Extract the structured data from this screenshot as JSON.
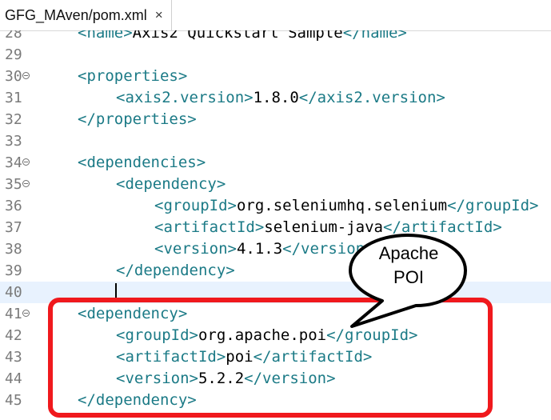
{
  "tab": {
    "title": "GFG_MAven/pom.xml",
    "close_glyph": "×"
  },
  "lines": [
    {
      "n": "28",
      "indent": 1,
      "parts": [
        [
          "tag",
          "<name>"
        ],
        [
          "txt",
          "Axis2 Quickstart Sample"
        ],
        [
          "tag",
          "</name>"
        ]
      ]
    },
    {
      "n": "29",
      "indent": 0,
      "parts": []
    },
    {
      "n": "30",
      "fold": true,
      "indent": 1,
      "parts": [
        [
          "tag",
          "<properties>"
        ]
      ]
    },
    {
      "n": "31",
      "indent": 2,
      "parts": [
        [
          "tag",
          "<axis2.version>"
        ],
        [
          "txt",
          "1.8.0"
        ],
        [
          "tag",
          "</axis2.version>"
        ]
      ]
    },
    {
      "n": "32",
      "indent": 1,
      "parts": [
        [
          "tag",
          "</properties>"
        ]
      ]
    },
    {
      "n": "33",
      "indent": 0,
      "parts": []
    },
    {
      "n": "34",
      "fold": true,
      "indent": 1,
      "parts": [
        [
          "tag",
          "<dependencies>"
        ]
      ]
    },
    {
      "n": "35",
      "fold": true,
      "indent": 2,
      "parts": [
        [
          "tag",
          "<dependency>"
        ]
      ]
    },
    {
      "n": "36",
      "indent": 3,
      "parts": [
        [
          "tag",
          "<groupId>"
        ],
        [
          "txt",
          "org.seleniumhq.selenium"
        ],
        [
          "tag",
          "</groupId>"
        ]
      ]
    },
    {
      "n": "37",
      "indent": 3,
      "parts": [
        [
          "tag",
          "<artifactId>"
        ],
        [
          "txt",
          "selenium-java"
        ],
        [
          "tag",
          "</artifactId>"
        ]
      ]
    },
    {
      "n": "38",
      "indent": 3,
      "parts": [
        [
          "tag",
          "<version>"
        ],
        [
          "txt",
          "4.1.3"
        ],
        [
          "tag",
          "</version>"
        ]
      ]
    },
    {
      "n": "39",
      "indent": 2,
      "parts": [
        [
          "tag",
          "</dependency>"
        ]
      ]
    },
    {
      "n": "40",
      "current": true,
      "indent": 0,
      "parts": []
    },
    {
      "n": "41",
      "fold": true,
      "indent": 1,
      "parts": [
        [
          "tag",
          "<dependency>"
        ]
      ]
    },
    {
      "n": "42",
      "indent": 2,
      "parts": [
        [
          "tag",
          "<groupId>"
        ],
        [
          "txt",
          "org.apache.poi"
        ],
        [
          "tag",
          "</groupId>"
        ]
      ]
    },
    {
      "n": "43",
      "indent": 2,
      "parts": [
        [
          "tag",
          "<artifactId>"
        ],
        [
          "txt",
          "poi"
        ],
        [
          "tag",
          "</artifactId>"
        ]
      ]
    },
    {
      "n": "44",
      "indent": 2,
      "parts": [
        [
          "tag",
          "<version>"
        ],
        [
          "txt",
          "5.2.2"
        ],
        [
          "tag",
          "</version>"
        ]
      ]
    },
    {
      "n": "45",
      "indent": 1,
      "parts": [
        [
          "tag",
          "</dependency>"
        ]
      ]
    }
  ],
  "callout": {
    "line1": "Apache",
    "line2": "POI"
  },
  "colors": {
    "tag": "#1b7a86",
    "text": "#000000",
    "highlight_border": "#f0191d",
    "current_line": "#e8f2fe"
  }
}
